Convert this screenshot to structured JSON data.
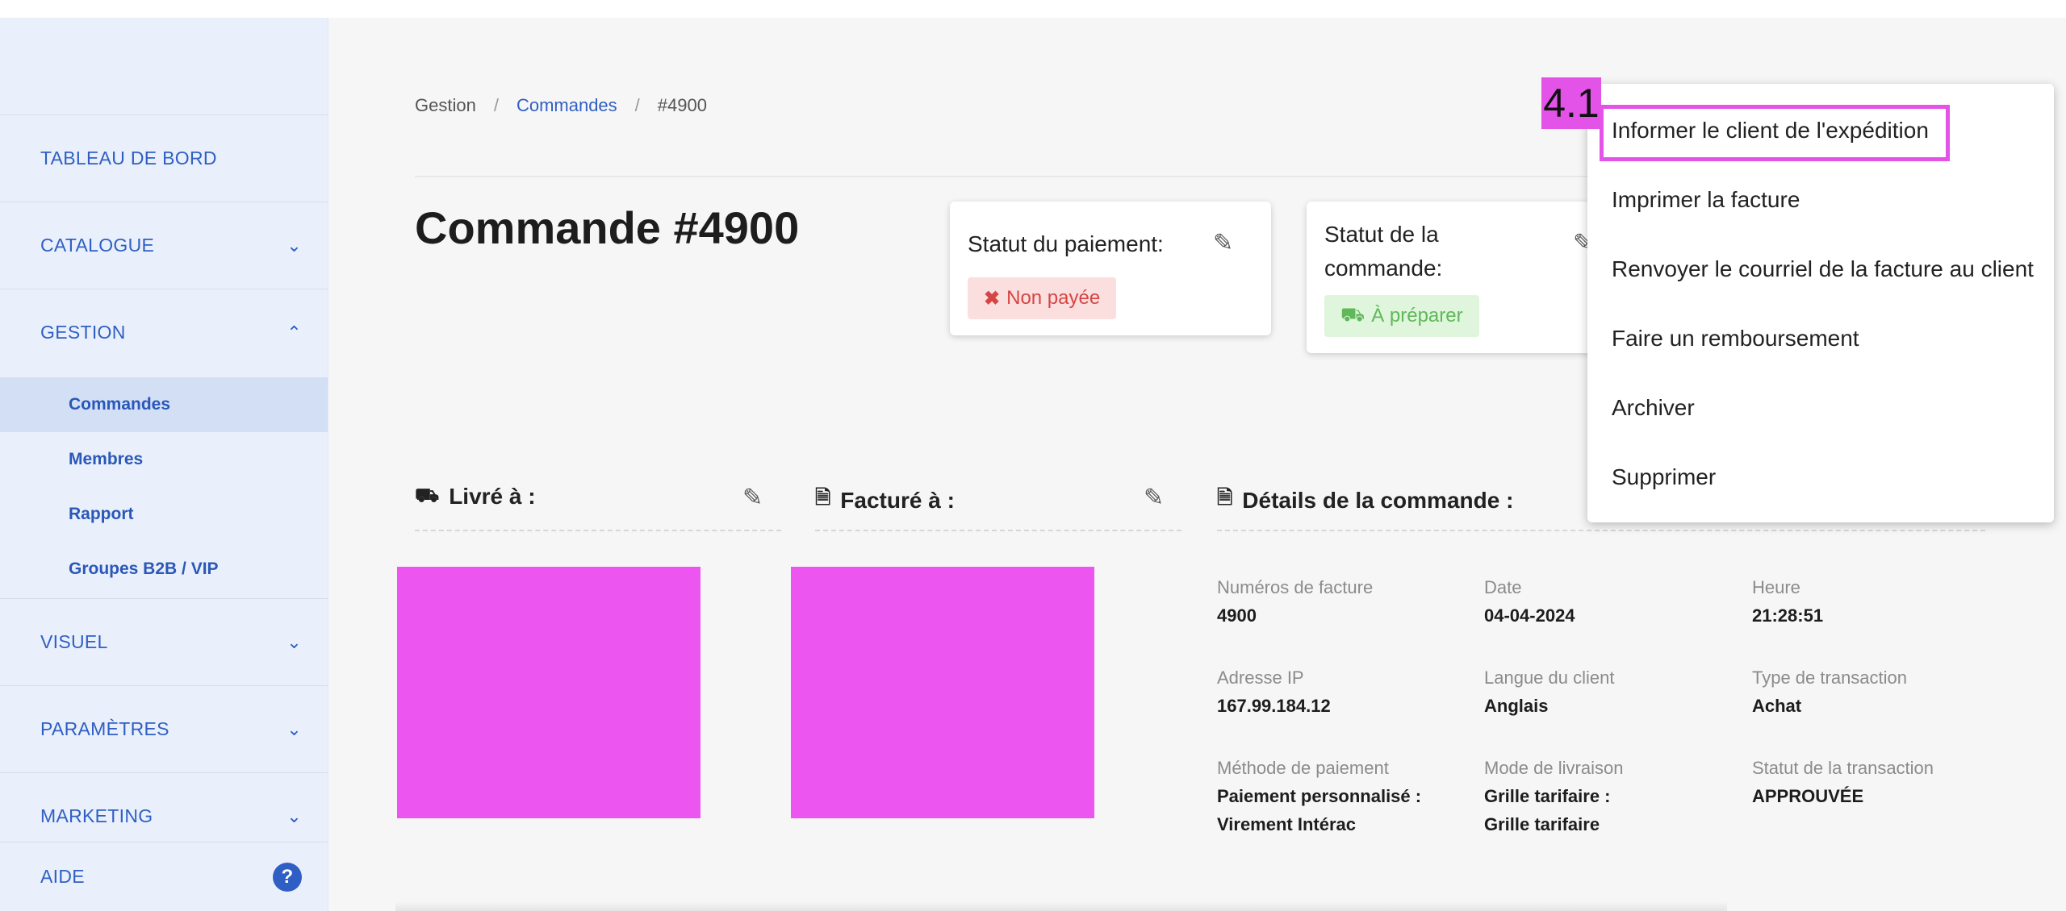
{
  "sidebar": {
    "items": [
      {
        "label": "TABLEAU DE BORD"
      },
      {
        "label": "CATALOGUE",
        "chevron": "chevron-down-icon"
      },
      {
        "label": "GESTION",
        "chevron": "chevron-up-icon"
      },
      {
        "label": "VISUEL",
        "chevron": "chevron-down-icon"
      },
      {
        "label": "PARAMÈTRES",
        "chevron": "chevron-down-icon"
      },
      {
        "label": "MARKETING",
        "chevron": "chevron-down-icon"
      },
      {
        "label": "AIDE",
        "icon": "help-icon"
      }
    ],
    "subitems": [
      {
        "label": "Commandes",
        "active": true
      },
      {
        "label": "Membres"
      },
      {
        "label": "Rapport"
      },
      {
        "label": "Groupes B2B / VIP"
      }
    ]
  },
  "breadcrumb": {
    "root": "Gestion",
    "section": "Commandes",
    "current": "#4900",
    "separator": "/"
  },
  "page_title": "Commande #4900",
  "payment_status": {
    "label": "Statut du paiement:",
    "value": "Non payée"
  },
  "order_status": {
    "label_line1": "Statut de la",
    "label_line2": "commande:",
    "value": "À préparer"
  },
  "sections": {
    "delivered_to": "Livré à :",
    "billed_to": "Facturé à :",
    "order_details": "Détails de la commande :"
  },
  "details": [
    {
      "label": "Numéros de facture",
      "value": "4900"
    },
    {
      "label": "Date",
      "value": "04-04-2024"
    },
    {
      "label": "Heure",
      "value": "21:28:51"
    },
    {
      "label": "Adresse IP",
      "value": "167.99.184.12"
    },
    {
      "label": "Langue du client",
      "value": "Anglais"
    },
    {
      "label": "Type de transaction",
      "value": "Achat"
    },
    {
      "label": "Méthode de paiement",
      "value_line1": "Paiement personnalisé :",
      "value_line2": "Virement Intérac"
    },
    {
      "label": "Mode de livraison",
      "value_line1": "Grille tarifaire :",
      "value_line2": "Grille tarifaire"
    },
    {
      "label": "Statut de la transaction",
      "value": "APPROUVÉE"
    }
  ],
  "dropdown": {
    "items": [
      {
        "label": "Informer le client de l'expédition"
      },
      {
        "label": "Imprimer la facture"
      },
      {
        "label": "Renvoyer le courriel de la facture au client"
      },
      {
        "label": "Faire un remboursement"
      },
      {
        "label": "Archiver"
      },
      {
        "label": "Supprimer"
      }
    ]
  },
  "annotation": {
    "tag": "4.1"
  },
  "colors": {
    "accent": "#2f5fc4",
    "highlight": "#e353e8",
    "danger": "#d64545",
    "success": "#5fb85a"
  }
}
